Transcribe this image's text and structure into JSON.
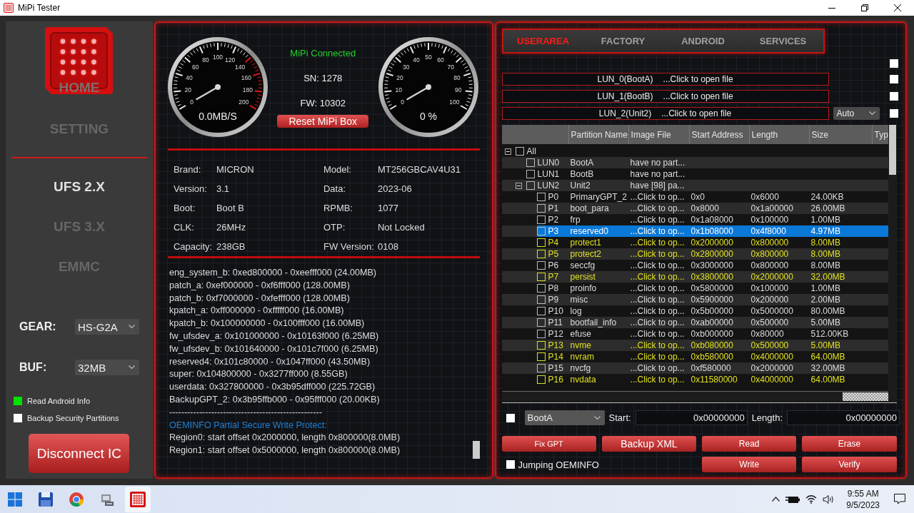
{
  "window": {
    "title": "MiPi Tester"
  },
  "sidebar": {
    "top_menu": [
      {
        "label": "HOME",
        "selected": false
      },
      {
        "label": "SETTING",
        "selected": false
      }
    ],
    "chip_types": [
      {
        "label": "UFS 2.X",
        "selected": true
      },
      {
        "label": "UFS 3.X",
        "selected": false
      },
      {
        "label": "EMMC",
        "selected": false
      }
    ],
    "settings": [
      {
        "label": "GEAR:",
        "value": "HS-G2A"
      },
      {
        "label": "BUF:",
        "value": "32MB"
      }
    ],
    "options": [
      {
        "label": "Read Android Info",
        "checked": true
      },
      {
        "label": "Backup Security Partitions",
        "checked": false
      }
    ],
    "disconnect_button": "Disconnect IC"
  },
  "device": {
    "gauges": [
      {
        "kind": "speed",
        "scale": [
          "100",
          "80",
          "120",
          "60",
          "140",
          "40",
          "160",
          "20",
          "180",
          "0",
          "200"
        ],
        "reading": "0.0MB/S"
      },
      {
        "kind": "percent",
        "scale": [
          "50",
          "40",
          "60",
          "30",
          "70",
          "20",
          "80",
          "10",
          "90",
          "0",
          "100"
        ],
        "reading": "0 %"
      }
    ],
    "status": "MiPi Connected",
    "sn": "SN: 1278",
    "fw": "FW: 10302",
    "reset_button": "Reset MiPi Box",
    "info": [
      {
        "label": "Brand:",
        "value": "MICRON"
      },
      {
        "label": "Model:",
        "value": "MT256GBCAV4U31"
      },
      {
        "label": "Version:",
        "value": "3.1"
      },
      {
        "label": "Data:",
        "value": "2023-06"
      },
      {
        "label": "Boot:",
        "value": "Boot B"
      },
      {
        "label": "RPMB:",
        "value": "1077"
      },
      {
        "label": "CLK:",
        "value": "26MHz"
      },
      {
        "label": "OTP:",
        "value": "Not Locked"
      },
      {
        "label": "Capacity:",
        "value": "238GB"
      },
      {
        "label": "FW Version:",
        "value": "0108"
      }
    ],
    "log": [
      {
        "kind": "text",
        "text": "eng_system_b: 0xed800000 - 0xeefff000 (24.00MB)"
      },
      {
        "kind": "text",
        "text": "patch_a: 0xef000000 - 0xf6fff000 (128.00MB)"
      },
      {
        "kind": "text",
        "text": "patch_b: 0xf7000000 - 0xfefff000 (128.00MB)"
      },
      {
        "kind": "text",
        "text": "kpatch_a: 0xff000000 - 0xfffff000 (16.00MB)"
      },
      {
        "kind": "text",
        "text": "kpatch_b: 0x100000000 - 0x100fff000 (16.00MB)"
      },
      {
        "kind": "text",
        "text": "fw_ufsdev_a: 0x101000000 - 0x10163f000 (6.25MB)"
      },
      {
        "kind": "text",
        "text": "fw_ufsdev_b: 0x101640000 - 0x101c7f000 (6.25MB)"
      },
      {
        "kind": "text",
        "text": "reserved4: 0x101c80000 - 0x1047ff000 (43.50MB)"
      },
      {
        "kind": "text",
        "text": "super: 0x104800000 - 0x3277ff000 (8.55GB)"
      },
      {
        "kind": "text",
        "text": "userdata: 0x327800000 - 0x3b95dff000 (225.72GB)"
      },
      {
        "kind": "text",
        "text": "BackupGPT_2: 0x3b95ffb000 - 0x95fff000 (20.00KB)"
      },
      {
        "kind": "separator",
        "text": "---------------------------------------------------"
      },
      {
        "kind": "heading",
        "text": "OEMINFO Partial Secure Write Protect:"
      },
      {
        "kind": "text",
        "text": "Region0: start offset 0x2000000, length 0x800000(8.0MB)"
      },
      {
        "kind": "text",
        "text": "Region1: start offset 0x5000000, length 0x800000(8.0MB)"
      }
    ]
  },
  "partitions": {
    "tabs": [
      {
        "label": "USERAREA",
        "selected": true
      },
      {
        "label": "FACTORY",
        "selected": false
      },
      {
        "label": "ANDROID",
        "selected": false
      },
      {
        "label": "SERVICES",
        "selected": false
      }
    ],
    "select_all": {
      "checked": false
    },
    "files": [
      {
        "label": "LUN_0(BootA)",
        "hint": "...Click to open file",
        "checked": false
      },
      {
        "label": "LUN_1(BootB)",
        "hint": "...Click to open file",
        "checked": false
      },
      {
        "label": "LUN_2(Unit2)",
        "hint": "...Click to open file",
        "mode": "Auto",
        "checked": false
      }
    ],
    "table": {
      "columns": [
        "Partition Name",
        "Image File",
        "Start Address",
        "Length",
        "Size",
        "Typ"
      ],
      "tree": [
        {
          "id": "All",
          "checked": false,
          "selected": false,
          "expanded": true,
          "children": [
            {
              "id": "LUN0",
              "name": "BootA",
              "image": "have no part...",
              "checked": false,
              "selected": false
            },
            {
              "id": "LUN1",
              "name": "BootB",
              "image": "have no part...",
              "checked": false,
              "selected": false
            },
            {
              "id": "LUN2",
              "name": "Unit2",
              "image": "have [98] pa...",
              "checked": false,
              "selected": false,
              "expanded": true,
              "children": [
                {
                  "id": "P0",
                  "name": "PrimaryGPT_2",
                  "image": "...Click to op...",
                  "start": "0x0",
                  "length": "0x6000",
                  "size": "24.00KB",
                  "checked": false,
                  "selected": false,
                  "highlighted": false
                },
                {
                  "id": "P1",
                  "name": "boot_para",
                  "image": "...Click to op...",
                  "start": "0x8000",
                  "length": "0x1a00000",
                  "size": "26.00MB",
                  "checked": false,
                  "selected": false,
                  "highlighted": false
                },
                {
                  "id": "P2",
                  "name": "frp",
                  "image": "...Click to op...",
                  "start": "0x1a08000",
                  "length": "0x100000",
                  "size": "1.00MB",
                  "checked": false,
                  "selected": false,
                  "highlighted": false
                },
                {
                  "id": "P3",
                  "name": "reserved0",
                  "image": "...Click to op...",
                  "start": "0x1b08000",
                  "length": "0x4f8000",
                  "size": "4.97MB",
                  "checked": false,
                  "selected": true,
                  "highlighted": false
                },
                {
                  "id": "P4",
                  "name": "protect1",
                  "image": "...Click to op...",
                  "start": "0x2000000",
                  "length": "0x800000",
                  "size": "8.00MB",
                  "checked": false,
                  "selected": false,
                  "highlighted": true
                },
                {
                  "id": "P5",
                  "name": "protect2",
                  "image": "...Click to op...",
                  "start": "0x2800000",
                  "length": "0x800000",
                  "size": "8.00MB",
                  "checked": false,
                  "selected": false,
                  "highlighted": true
                },
                {
                  "id": "P6",
                  "name": "seccfg",
                  "image": "...Click to op...",
                  "start": "0x3000000",
                  "length": "0x800000",
                  "size": "8.00MB",
                  "checked": false,
                  "selected": false,
                  "highlighted": false
                },
                {
                  "id": "P7",
                  "name": "persist",
                  "image": "...Click to op...",
                  "start": "0x3800000",
                  "length": "0x2000000",
                  "size": "32.00MB",
                  "checked": false,
                  "selected": false,
                  "highlighted": true
                },
                {
                  "id": "P8",
                  "name": "proinfo",
                  "image": "...Click to op...",
                  "start": "0x5800000",
                  "length": "0x100000",
                  "size": "1.00MB",
                  "checked": false,
                  "selected": false,
                  "highlighted": false
                },
                {
                  "id": "P9",
                  "name": "misc",
                  "image": "...Click to op...",
                  "start": "0x5900000",
                  "length": "0x200000",
                  "size": "2.00MB",
                  "checked": false,
                  "selected": false,
                  "highlighted": false
                },
                {
                  "id": "P10",
                  "name": "log",
                  "image": "...Click to op...",
                  "start": "0x5b00000",
                  "length": "0x5000000",
                  "size": "80.00MB",
                  "checked": false,
                  "selected": false,
                  "highlighted": false
                },
                {
                  "id": "P11",
                  "name": "bootfail_info",
                  "image": "...Click to op...",
                  "start": "0xab00000",
                  "length": "0x500000",
                  "size": "5.00MB",
                  "checked": false,
                  "selected": false,
                  "highlighted": false
                },
                {
                  "id": "P12",
                  "name": "efuse",
                  "image": "...Click to op...",
                  "start": "0xb000000",
                  "length": "0x80000",
                  "size": "512.00KB",
                  "checked": false,
                  "selected": false,
                  "highlighted": false
                },
                {
                  "id": "P13",
                  "name": "nvme",
                  "image": "...Click to op...",
                  "start": "0xb080000",
                  "length": "0x500000",
                  "size": "5.00MB",
                  "checked": false,
                  "selected": false,
                  "highlighted": true
                },
                {
                  "id": "P14",
                  "name": "nvram",
                  "image": "...Click to op...",
                  "start": "0xb580000",
                  "length": "0x4000000",
                  "size": "64.00MB",
                  "checked": false,
                  "selected": false,
                  "highlighted": true
                },
                {
                  "id": "P15",
                  "name": "nvcfg",
                  "image": "...Click to op...",
                  "start": "0xf580000",
                  "length": "0x2000000",
                  "size": "32.00MB",
                  "checked": false,
                  "selected": false,
                  "highlighted": false
                },
                {
                  "id": "P16",
                  "name": "nvdata",
                  "image": "...Click to op...",
                  "start": "0x11580000",
                  "length": "0x4000000",
                  "size": "64.00MB",
                  "checked": false,
                  "selected": false,
                  "highlighted": true
                }
              ]
            }
          ]
        }
      ]
    },
    "range": {
      "checked": false,
      "partition": "BootA",
      "start_label": "Start:",
      "start": "0x00000000",
      "length_label": "Length:",
      "length": "0x00000000"
    },
    "actions": [
      "Fix GPT",
      "Backup XML",
      "Read",
      "Erase"
    ],
    "jumping_oeminfo": {
      "label": "Jumping OEMINFO",
      "checked": false
    },
    "actions_2": [
      "Write",
      "Verify"
    ]
  },
  "taskbar": {
    "apps": [
      {
        "kind": "disk",
        "active": false
      },
      {
        "kind": "browser",
        "active": false
      },
      {
        "kind": "tool",
        "active": false
      },
      {
        "kind": "app",
        "active": true
      }
    ],
    "time": "9:55 AM",
    "date": "9/5/2023"
  }
}
